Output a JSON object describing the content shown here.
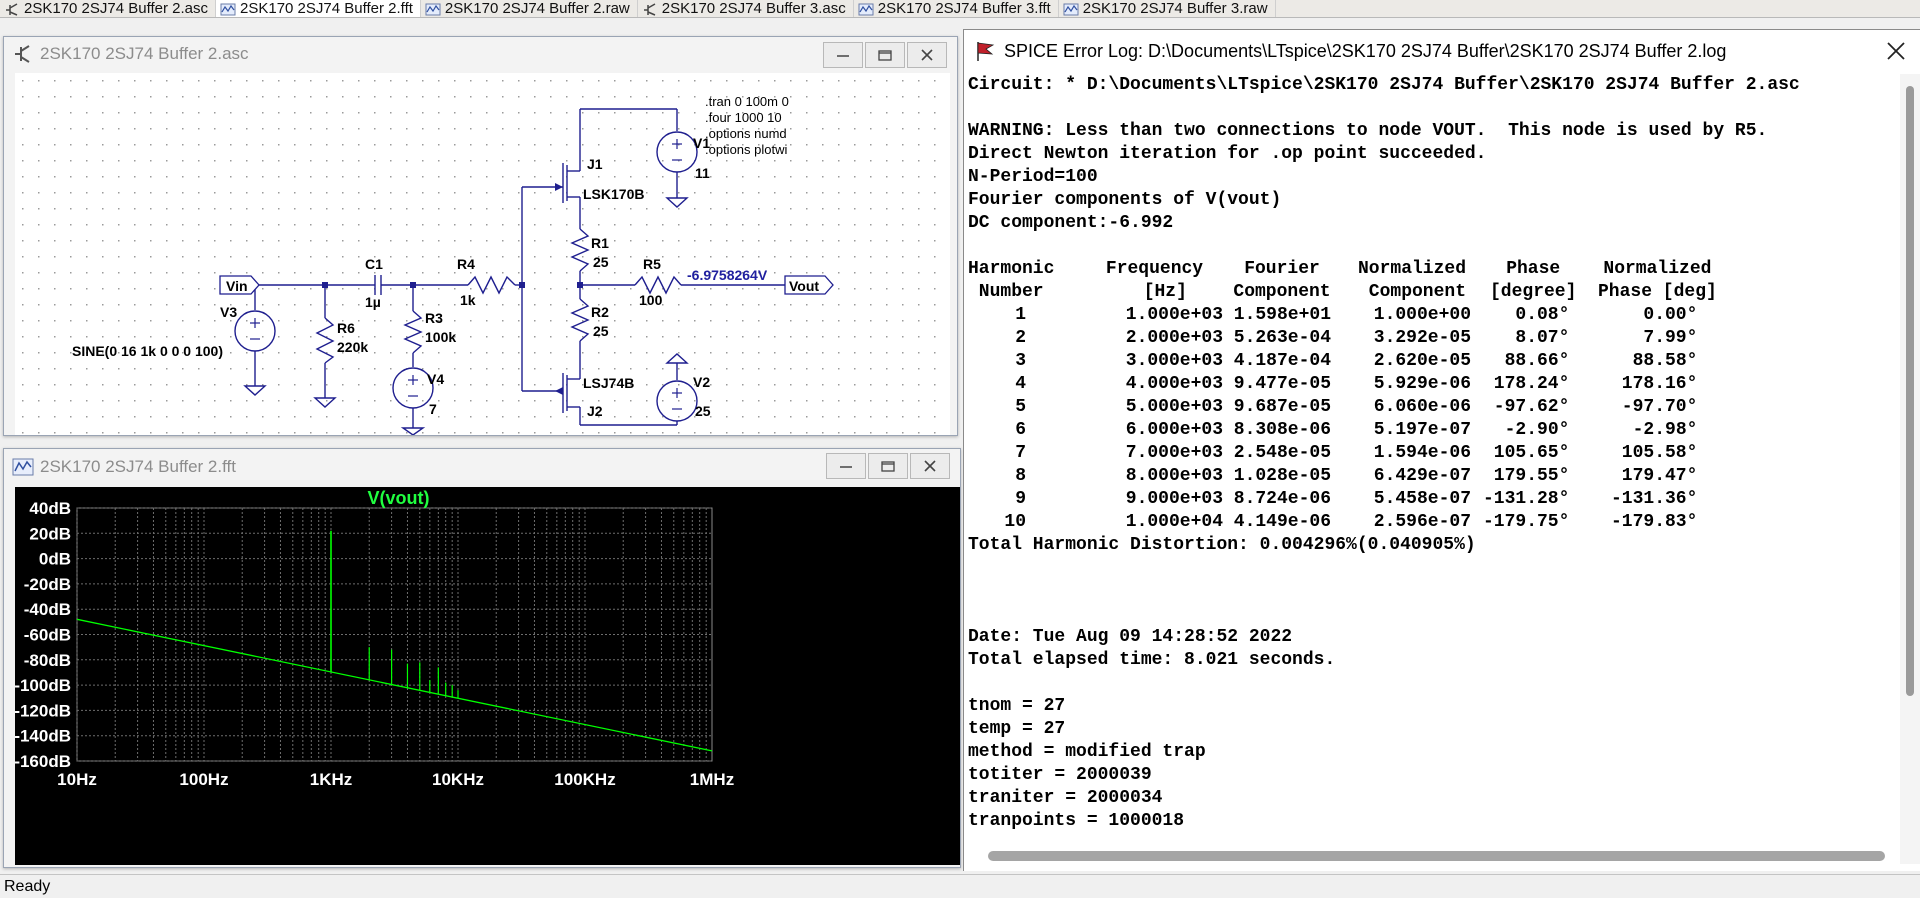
{
  "tabs": [
    {
      "label": "2SK170 2SJ74 Buffer 2.asc",
      "icon": "schematic-icon",
      "active": false
    },
    {
      "label": "2SK170 2SJ74 Buffer 2.fft",
      "icon": "waveform-icon",
      "active": true
    },
    {
      "label": "2SK170 2SJ74 Buffer 2.raw",
      "icon": "waveform-icon",
      "active": false
    },
    {
      "label": "2SK170 2SJ74 Buffer 3.asc",
      "icon": "schematic-icon",
      "active": false
    },
    {
      "label": "2SK170 2SJ74 Buffer 3.fft",
      "icon": "waveform-icon",
      "active": false
    },
    {
      "label": "2SK170 2SJ74 Buffer 3.raw",
      "icon": "waveform-icon",
      "active": false
    }
  ],
  "schematic_window": {
    "title": "2SK170 2SJ74 Buffer 2.asc",
    "directives": [
      ".tran 0 100m 0",
      ".four 1000 10",
      ".options numd",
      ".options plotwi"
    ],
    "labels": {
      "vin": "Vin",
      "vout": "Vout",
      "c1": "C1",
      "c1_val": "1µ",
      "r4": "R4",
      "r4_val": "1k",
      "r5": "R5",
      "r5_val": "100",
      "r6": "R6",
      "r6_val": "220k",
      "r3": "R3",
      "r3_val": "100k",
      "r1": "R1",
      "r1_val": "25",
      "r2": "R2",
      "r2_val": "25",
      "v1": "V1",
      "v1_val": "11",
      "v2": "V2",
      "v2_val": "25",
      "v3": "V3",
      "v3_val": "SINE(0 16 1k 0 0 0 100)",
      "v4": "V4",
      "v4_val": "7",
      "j1": "J1",
      "j1_model": "LSK170B",
      "j2": "J2",
      "j2_model": "LSJ74B",
      "vout_value": "-6.9758264V"
    }
  },
  "fft_window": {
    "title": "2SK170 2SJ74 Buffer 2.fft",
    "chart_data": {
      "type": "line",
      "title": "V(vout)",
      "x_scale": "log",
      "xlim": [
        10,
        1000000
      ],
      "ylim": [
        -160,
        40
      ],
      "x_tick_labels": [
        "10Hz",
        "100Hz",
        "1KHz",
        "10KHz",
        "100KHz",
        "1MHz"
      ],
      "x_tick_values": [
        10,
        100,
        1000,
        10000,
        100000,
        1000000
      ],
      "y_tick_labels": [
        "40dB",
        "20dB",
        "0dB",
        "-20dB",
        "-40dB",
        "-60dB",
        "-80dB",
        "-100dB",
        "-120dB",
        "-140dB",
        "-160dB"
      ],
      "y_tick_values": [
        40,
        20,
        0,
        -20,
        -40,
        -60,
        -80,
        -100,
        -120,
        -140,
        -160
      ],
      "grid": true,
      "noise_floor": {
        "x": [
          10,
          1000000
        ],
        "y": [
          -48,
          -152
        ]
      },
      "spikes": [
        {
          "x": 1000,
          "y": 22
        },
        {
          "x": 2000,
          "y": -70
        },
        {
          "x": 3000,
          "y": -72
        },
        {
          "x": 4000,
          "y": -83
        },
        {
          "x": 5000,
          "y": -82
        },
        {
          "x": 6000,
          "y": -96
        },
        {
          "x": 7000,
          "y": -86
        },
        {
          "x": 8000,
          "y": -98
        },
        {
          "x": 9000,
          "y": -100
        },
        {
          "x": 10000,
          "y": -104
        }
      ]
    }
  },
  "log_window": {
    "title": "SPICE Error Log: D:\\Documents\\LTspice\\2SK170 2SJ74 Buffer\\2SK170 2SJ74 Buffer 2.log",
    "lines_top": [
      "Circuit: * D:\\Documents\\LTspice\\2SK170 2SJ74 Buffer\\2SK170 2SJ74 Buffer 2.asc",
      "",
      "WARNING: Less than two connections to node VOUT.  This node is used by R5.",
      "Direct Newton iteration for .op point succeeded.",
      "N-Period=100",
      "Fourier components of V(vout)",
      "DC component:-6.992",
      ""
    ],
    "table_header_1": [
      "Harmonic",
      "Frequency",
      "Fourier",
      "Normalized",
      "Phase",
      "Normalized"
    ],
    "table_header_2": [
      " Number",
      "  [Hz]",
      "Component",
      " Component",
      "[degree]",
      "Phase [deg]"
    ],
    "table_rows": [
      [
        "1",
        "1.000e+03",
        "1.598e+01",
        "1.000e+00",
        "0.08°",
        "0.00°"
      ],
      [
        "2",
        "2.000e+03",
        "5.263e-04",
        "3.292e-05",
        "8.07°",
        "7.99°"
      ],
      [
        "3",
        "3.000e+03",
        "4.187e-04",
        "2.620e-05",
        "88.66°",
        "88.58°"
      ],
      [
        "4",
        "4.000e+03",
        "9.477e-05",
        "5.929e-06",
        "178.24°",
        "178.16°"
      ],
      [
        "5",
        "5.000e+03",
        "9.687e-05",
        "6.060e-06",
        "-97.62°",
        "-97.70°"
      ],
      [
        "6",
        "6.000e+03",
        "8.308e-06",
        "5.197e-07",
        "-2.90°",
        "-2.98°"
      ],
      [
        "7",
        "7.000e+03",
        "2.548e-05",
        "1.594e-06",
        "105.65°",
        "105.58°"
      ],
      [
        "8",
        "8.000e+03",
        "1.028e-05",
        "6.429e-07",
        "179.55°",
        "179.47°"
      ],
      [
        "9",
        "9.000e+03",
        "8.724e-06",
        "5.458e-07",
        "-131.28°",
        "-131.36°"
      ],
      [
        "10",
        "1.000e+04",
        "4.149e-06",
        "2.596e-07",
        "-179.75°",
        "-179.83°"
      ]
    ],
    "thd_line": "Total Harmonic Distortion: 0.004296%(0.040905%)",
    "lines_bottom": [
      "",
      "",
      "",
      "Date: Tue Aug 09 14:28:52 2022",
      "Total elapsed time: 8.021 seconds.",
      "",
      "tnom = 27",
      "temp = 27",
      "method = modified trap",
      "totiter = 2000039",
      "traniter = 2000034",
      "tranpoints = 1000018"
    ]
  },
  "status": "Ready",
  "colors": {
    "plot_bg": "#000000",
    "trace": "#00ff00",
    "net_label": "#1f1f9f",
    "title_text": "#20ff40"
  }
}
